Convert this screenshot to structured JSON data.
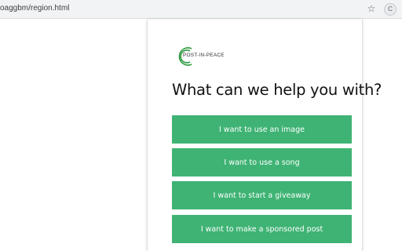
{
  "browser": {
    "url": "oaggbm/region.html",
    "bookmark_icon": "star-icon",
    "extension_icon_label": "C"
  },
  "popup": {
    "logo_text": "POST-IN-PEACE",
    "heading": "What can we help you with?",
    "options": [
      "I want to use an image",
      "I want to use a song",
      "I want to start a giveaway",
      "I want to make a sponsored post"
    ],
    "colors": {
      "button": "#3fb374",
      "logo": "#2e9a3e"
    }
  }
}
